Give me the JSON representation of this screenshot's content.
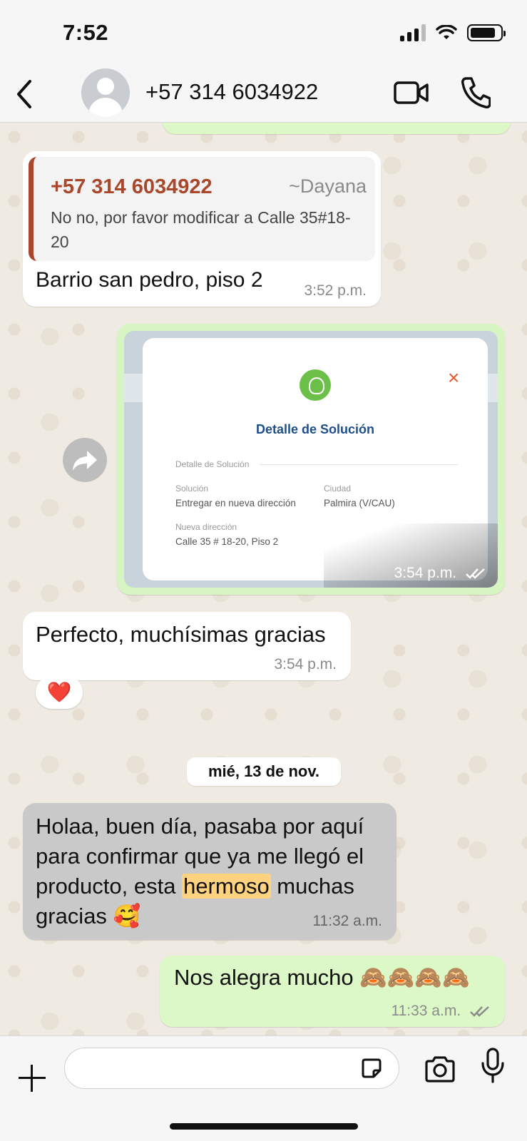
{
  "status_bar": {
    "time": "7:52"
  },
  "header": {
    "contact_name": "+57 314 6034922",
    "back_icon": "chevron-left-icon",
    "video_icon": "video-camera-icon",
    "call_icon": "phone-icon"
  },
  "messages": {
    "quoted_reply": {
      "quote_author": "+57 314 6034922",
      "quote_alias": "~Dayana",
      "quote_text": "No no, por favor modificar a Calle 35#18-20",
      "text": "Barrio san pedro, piso 2",
      "time": "3:52 p.m."
    },
    "image_message": {
      "card_title": "Detalle de Solución",
      "section_label": "Detalle de Solución",
      "solution_label": "Solución",
      "solution_value": "Entregar en nueva dirección",
      "city_label": "Ciudad",
      "city_value": "Palmira (V/CAU)",
      "new_address_label": "Nueva dirección",
      "new_address_value": "Calle 35 # 18-20, Piso 2",
      "close_symbol": "×",
      "time": "3:54 p.m.",
      "forward_icon": "forward-arrow-icon"
    },
    "thanks": {
      "text": "Perfecto, muchísimas gracias",
      "time": "3:54 p.m.",
      "reaction": "❤️"
    },
    "date_separator": "mié, 13 de nov.",
    "confirmation": {
      "text_before": "Holaa, buen día, pasaba por aquí para confirmar que ya me llegó el producto, esta ",
      "highlight": "hermoso",
      "text_after": " muchas gracias 🥰",
      "time": "11:32 a.m."
    },
    "reply": {
      "text": "Nos alegra mucho 🙈🙈🙈🙈",
      "time": "11:33 a.m."
    }
  },
  "composer": {
    "placeholder": "",
    "plus_icon": "plus-icon",
    "sticker_icon": "sticker-icon",
    "camera_icon": "camera-icon",
    "mic_icon": "microphone-icon"
  },
  "colors": {
    "outgoing_bubble": "#dcf8c6",
    "incoming_bubble": "#ffffff",
    "highlighted_bubble": "#c9c9c9",
    "quote_accent": "#a8472b",
    "card_title": "#1f4e8c",
    "highlight": "#ffd280"
  }
}
